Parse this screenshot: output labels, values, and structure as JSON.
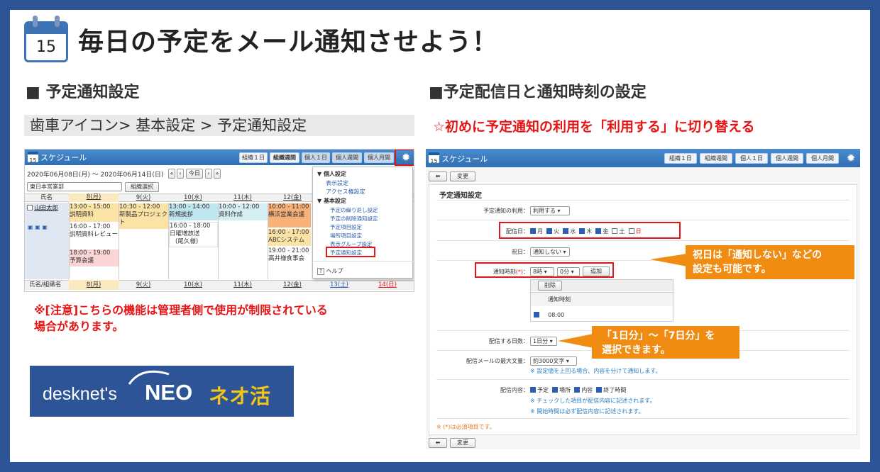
{
  "header": {
    "icon_number": "15",
    "title": "毎日の予定をメール通知させよう！"
  },
  "left": {
    "section": "■ 予定通知設定",
    "breadcrumb": "歯車アイコン> 基本設定 > 予定通知設定",
    "note_line1": "※[注意]こちらの機能は管理者側で使用が制限されている",
    "note_line2": "場合があります。",
    "logo_text": "desknet's",
    "logo_neo": "NEO",
    "logo_katsu": "ネオ活"
  },
  "right": {
    "section": "■予定配信日と通知時刻の設定",
    "subtitle": "☆初めに予定通知の利用を「利用する」に切り替える"
  },
  "app": {
    "title": "スケジュール",
    "icon_number": "15",
    "tabs": [
      "組織１日",
      "組織週間",
      "個人１日",
      "個人週間",
      "個人月間"
    ]
  },
  "calendar": {
    "range": "2020年06月08日(月) ～ 2020年06月14日(日)",
    "today": "今日",
    "org_select": "東日本営業部",
    "org_btn": "組織選択",
    "name_header": "氏名",
    "name_header2": "氏名/組織名",
    "user": "山田太郎",
    "days": [
      "8(月)",
      "9(火)",
      "10(水)",
      "11(木)",
      "12(金)",
      "13(土)",
      "14(日)"
    ],
    "events": {
      "mon1_time": "13:00 - 15:00",
      "mon1_title": "説明資料",
      "mon2_time": "16:00 - 17:00",
      "mon2_title": "説明資料レビュー",
      "mon3_time": "18:00 - 19:00",
      "mon3_title": "予算会議",
      "tue1_time": "10:30 - 12:00",
      "tue1_title": "新製品プロジェクト",
      "wed1_time": "13:00 - 14:00",
      "wed1_title": "新規挨拶",
      "wed2_time": "16:00 - 18:00",
      "wed2_title": "日曜増放送",
      "wed2_sub": "(尾久様)",
      "thu1_time": "10:00 - 12:00",
      "thu1_title": "資料作成",
      "fri1_time": "10:00 - 11:00",
      "fri1_title": "横浜営業会議",
      "fri2_time": "16:00 - 17:00",
      "fri2_title": "ABCシステム",
      "fri3_time": "19:00 - 21:00",
      "fri3_title": "高井様食事会"
    }
  },
  "menu": {
    "personal": "個人設定",
    "personal_items": [
      "表示設定",
      "アクセス権設定"
    ],
    "basic": "基本設定",
    "basic_items": [
      "予定の繰り返し設定",
      "予定の削除通知設定",
      "予定項目設定",
      "場所項目設定",
      "表示グループ設定",
      "予定通知設定"
    ],
    "help": "ヘルプ"
  },
  "form": {
    "back": "◆",
    "change": "変更",
    "heading": "予定通知設定",
    "use_label": "予定通知の利用：",
    "use_value": "利用する",
    "days_label": "配信日：",
    "days": [
      "月",
      "火",
      "水",
      "木",
      "金",
      "土",
      "日"
    ],
    "holiday_label": "祝日：",
    "holiday_value": "通知しない",
    "time_label": "通知時刻",
    "required_mark": "(*)",
    "time_colon": "：",
    "hour": "8時",
    "minute": "0分",
    "add": "追加",
    "delete": "削除",
    "time_col": "通知時刻",
    "time_row": "08:00",
    "deliver_days_label": "配信する日数：",
    "deliver_days_value": "1日分",
    "max_label": "配信メールの最大文量：",
    "max_value": "約3000文字",
    "max_note": "※ 設定値を上回る場合、内容を分けて通知します。",
    "content_label": "配信内容：",
    "content_items": [
      "予定",
      "場所",
      "内容",
      "終了時間"
    ],
    "content_note1": "※ チェックした項目が配信内容に記述されます。",
    "content_note2": "※ 開始時間は必ず配信内容に記述されます。",
    "required_note": "※ (*)は必須項目です。"
  },
  "callouts": {
    "holiday1": "祝日は「通知しない」などの",
    "holiday2": "設定も可能です。",
    "days1": "「1日分」～「7日分」を",
    "days2": "選択できます。"
  },
  "colors": {
    "brand": "#2c5497",
    "accent_red": "#e61515",
    "callout": "#f08c11",
    "app_bar": "#3a7fc3"
  }
}
